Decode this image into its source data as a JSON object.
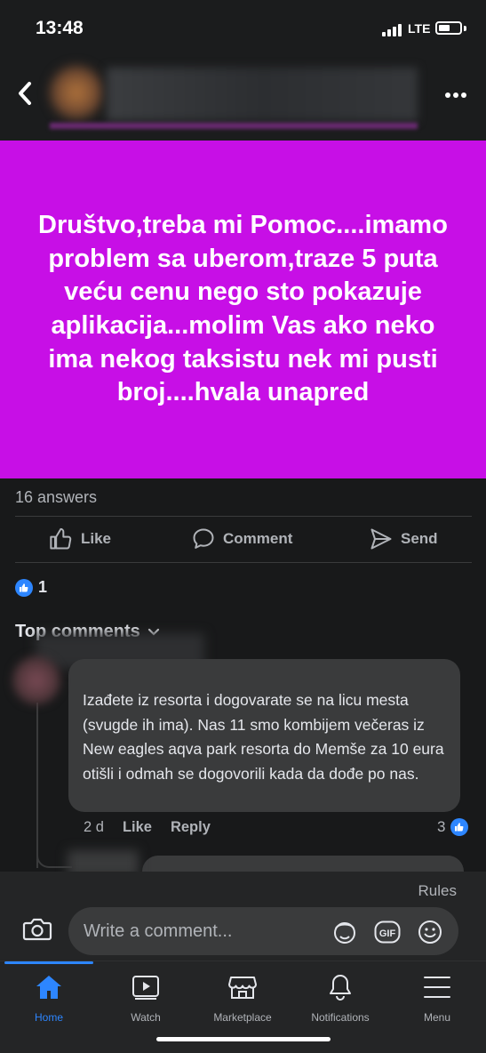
{
  "status_bar": {
    "time": "13:48",
    "network": "LTE"
  },
  "header": {
    "back_icon": "chevron-left-icon",
    "more_icon": "more-horizontal-icon"
  },
  "post": {
    "text": "Društvo,treba mi Pomoc....imamo problem sa uberom,traze 5 puta veću cenu nego sto pokazuje aplikacija...molim Vas ako neko ima nekog taksistu nek mi pusti broj....hvala unapred",
    "background_color": "#c70fe6",
    "answers": "16 answers",
    "reaction_count": "1"
  },
  "actions": {
    "like": "Like",
    "comment": "Comment",
    "send": "Send"
  },
  "comments_section": {
    "heading": "Top comments",
    "comment": {
      "text": "Izađete iz resorta i dogovarate se na licu mesta (svugde ih ima). Nas 11 smo kombijem večeras iz New eagles aqva park resorta do Memše za 10 eura otišli i odmah se dogovorili kada da dođe po nas.",
      "time": "2 d",
      "like": "Like",
      "reply": "Reply",
      "likes": "3"
    }
  },
  "composer": {
    "rules": "Rules",
    "placeholder": "Write a comment..."
  },
  "tabs": [
    {
      "label": "Home",
      "icon": "home-icon",
      "active": true
    },
    {
      "label": "Watch",
      "icon": "watch-icon",
      "active": false
    },
    {
      "label": "Marketplace",
      "icon": "marketplace-icon",
      "active": false
    },
    {
      "label": "Notifications",
      "icon": "bell-icon",
      "active": false
    },
    {
      "label": "Menu",
      "icon": "menu-icon",
      "active": false
    }
  ],
  "colors": {
    "accent": "#2d86ff",
    "background": "#18191a"
  }
}
